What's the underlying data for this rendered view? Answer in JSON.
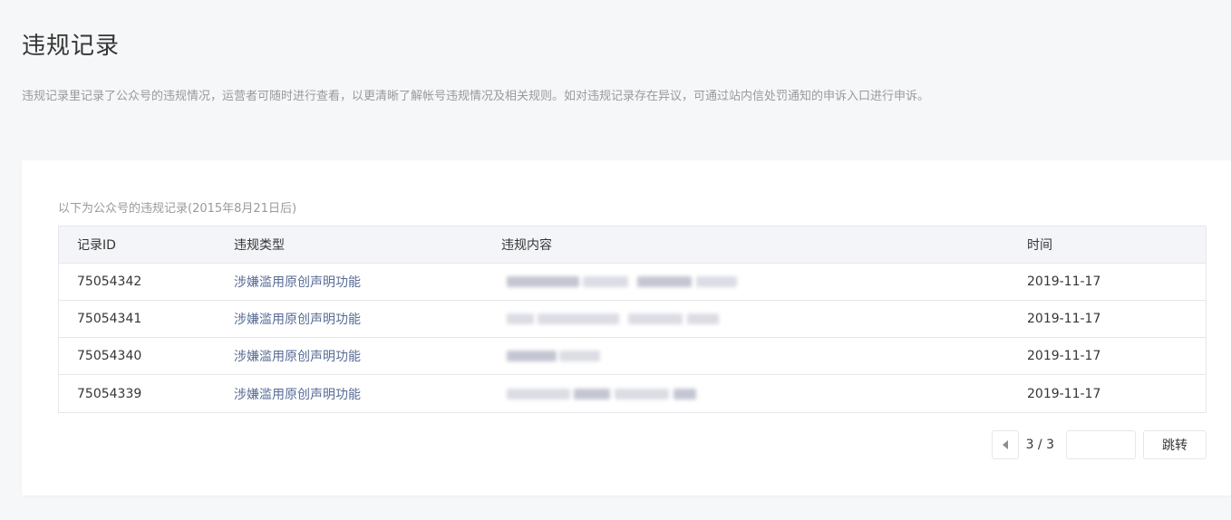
{
  "page": {
    "title": "违规记录",
    "description": "违规记录里记录了公众号的违规情况，运营者可随时进行查看，以更清晰了解帐号违规情况及相关规则。如对违规记录存在异议，可通过站内信处罚通知的申诉入口进行申诉。"
  },
  "records": {
    "caption": "以下为公众号的违规记录(2015年8月21日后)",
    "columns": [
      "记录ID",
      "违规类型",
      "违规内容",
      "时间"
    ],
    "rows": [
      {
        "id": "75054342",
        "type": "涉嫌滥用原创声明功能",
        "content": "",
        "time": "2019-11-17"
      },
      {
        "id": "75054341",
        "type": "涉嫌滥用原创声明功能",
        "content": "",
        "time": "2019-11-17"
      },
      {
        "id": "75054340",
        "type": "涉嫌滥用原创声明功能",
        "content": "",
        "time": "2019-11-17"
      },
      {
        "id": "75054339",
        "type": "涉嫌滥用原创声明功能",
        "content": "",
        "time": "2019-11-17"
      }
    ]
  },
  "pagination": {
    "current": "3 / 3",
    "input_value": "",
    "go_label": "跳转",
    "prev_icon": "caret-left-icon"
  },
  "colors": {
    "background": "#f6f7f9",
    "card": "#ffffff",
    "link": "#576b95",
    "muted_text": "#9a9a9a",
    "border": "#e7e7eb"
  }
}
